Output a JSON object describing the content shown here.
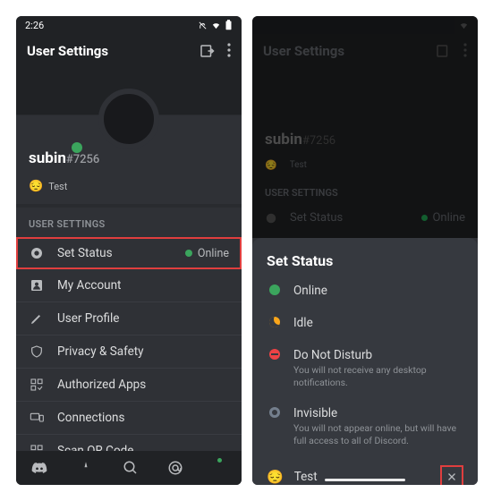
{
  "left": {
    "time": "2:26",
    "header_title": "User Settings",
    "username": "subin",
    "discriminator": "#7256",
    "custom_status_emoji": "😔",
    "custom_status_text": "Test",
    "section_label": "USER SETTINGS",
    "rows": {
      "set_status": {
        "label": "Set Status",
        "value": "Online"
      },
      "my_account": {
        "label": "My Account"
      },
      "user_profile": {
        "label": "User Profile"
      },
      "privacy_safety": {
        "label": "Privacy & Safety"
      },
      "authorized_apps": {
        "label": "Authorized Apps"
      },
      "connections": {
        "label": "Connections"
      },
      "scan_qr": {
        "label": "Scan QR Code"
      }
    }
  },
  "right": {
    "header_title": "User Settings",
    "dim_username": "subin",
    "dim_discriminator": "#7256",
    "dim_custom_emoji": "😔",
    "dim_custom_text": "Test",
    "dim_section_label": "USER SETTINGS",
    "dim_row_label": "Set Status",
    "dim_row_value": "Online",
    "sheet_title": "Set Status",
    "options": {
      "online": {
        "name": "Online"
      },
      "idle": {
        "name": "Idle"
      },
      "dnd": {
        "name": "Do Not Disturb",
        "desc": "You will not receive any desktop notifications."
      },
      "invisible": {
        "name": "Invisible",
        "desc": "You will not appear online, but will have full access to all of Discord."
      }
    },
    "custom": {
      "emoji": "😔",
      "text": "Test"
    }
  },
  "colors": {
    "accent_green": "#3ba55d",
    "highlight_red": "#e03e3e",
    "bg_dark": "#2f3136",
    "bg_darker": "#202225"
  }
}
